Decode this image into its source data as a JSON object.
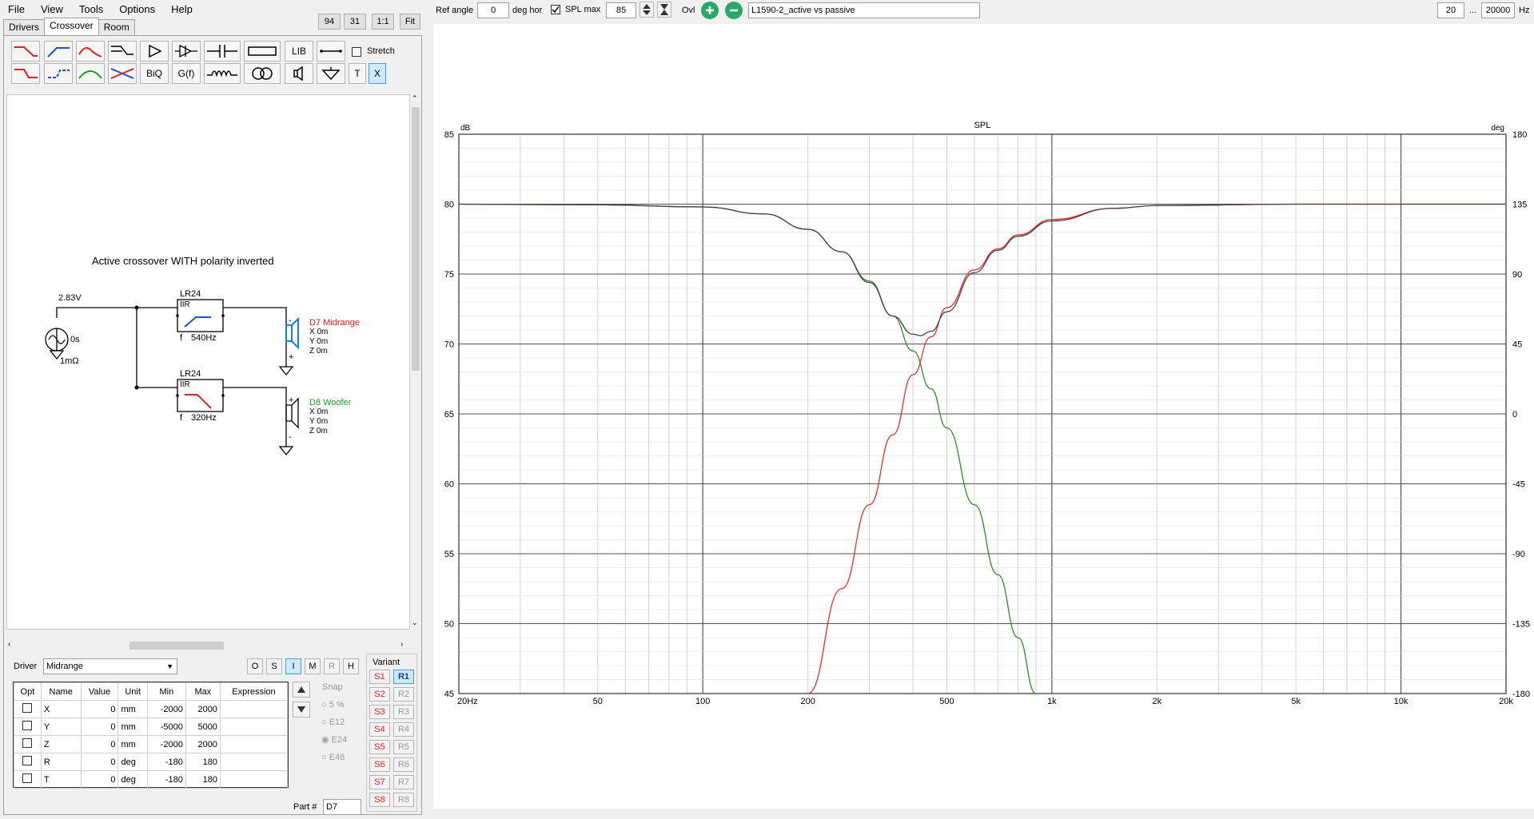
{
  "menu": [
    "File",
    "View",
    "Tools",
    "Options",
    "Help"
  ],
  "zoom_buttons": [
    "94",
    "31",
    "1:1",
    "Fit"
  ],
  "tabs": [
    "Drivers",
    "Crossover",
    "Room"
  ],
  "toolbar": {
    "lib": "LIB",
    "stretch": "Stretch",
    "biq": "BiQ",
    "gf": "G(f)",
    "t": "T",
    "x": "X"
  },
  "schematic": {
    "title": "Active crossover WITH polarity inverted",
    "source": {
      "voltage": "2.83V",
      "delay": "0s",
      "impedance": "1mΩ"
    },
    "block1": {
      "type": "LR24",
      "kind": "IIR",
      "freq_label": "f",
      "freq": "540Hz"
    },
    "block2": {
      "type": "LR24",
      "kind": "IIR",
      "freq_label": "f",
      "freq": "320Hz"
    },
    "driver1": {
      "name": "D7 Midrange",
      "x": "X 0m",
      "y": "Y 0m",
      "z": "Z 0m",
      "minus": "-",
      "plus": "+"
    },
    "driver2": {
      "name": "D8 Woofer",
      "x": "X 0m",
      "y": "Y 0m",
      "z": "Z 0m",
      "minus": "-",
      "plus": "+"
    }
  },
  "driver_panel": {
    "label": "Driver",
    "selected": "Midrange",
    "mode_buttons": [
      "O",
      "S",
      "I",
      "M",
      "R",
      "H"
    ],
    "columns": [
      "Opt",
      "Name",
      "Value",
      "Unit",
      "Min",
      "Max",
      "Expression"
    ],
    "rows": [
      {
        "name": "X",
        "value": "0",
        "unit": "mm",
        "min": "-2000",
        "max": "2000"
      },
      {
        "name": "Y",
        "value": "0",
        "unit": "mm",
        "min": "-5000",
        "max": "5000"
      },
      {
        "name": "Z",
        "value": "0",
        "unit": "mm",
        "min": "-2000",
        "max": "2000"
      },
      {
        "name": "R",
        "value": "0",
        "unit": "deg",
        "min": "-180",
        "max": "180"
      },
      {
        "name": "T",
        "value": "0",
        "unit": "deg",
        "min": "-180",
        "max": "180"
      }
    ],
    "snap": {
      "label": "Snap",
      "options": [
        "5 %",
        "E12",
        "E24",
        "E48"
      ],
      "selected": "E24"
    },
    "part_label": "Part #",
    "part": "D7",
    "variant_label": "Variant",
    "variants_s": [
      "S1",
      "S2",
      "S3",
      "S4",
      "S5",
      "S6",
      "S7",
      "S8"
    ],
    "variants_r": [
      "R1",
      "R2",
      "R3",
      "R4",
      "R5",
      "R6",
      "R7",
      "R8"
    ]
  },
  "top": {
    "ref_angle_label": "Ref angle",
    "ref_angle": "0",
    "deg_hor": "deg hor",
    "spl_max_label": "SPL max",
    "spl_max": "85",
    "ovl": "Ovl",
    "title": "L1590-2_active vs passive",
    "fmin": "20",
    "dots": "...",
    "fmax": "20000",
    "hz": "Hz"
  },
  "chart_data": {
    "type": "line",
    "title": "SPL",
    "ylabel": "dB",
    "y2label": "deg",
    "x_scale": "log",
    "xlim": [
      20,
      20000
    ],
    "ylim": [
      45,
      85
    ],
    "y2lim": [
      -180,
      180
    ],
    "x_ticks": [
      "20Hz",
      "50",
      "100",
      "200",
      "500",
      "1k",
      "2k",
      "5k",
      "10k",
      "20k"
    ],
    "y_ticks": [
      "85",
      "80",
      "75",
      "70",
      "65",
      "60",
      "55",
      "50",
      "45"
    ],
    "y2_ticks": [
      "180",
      "135",
      "90",
      "45",
      "0",
      "-45",
      "-90",
      "-135",
      "-180"
    ],
    "grid": true,
    "series": [
      {
        "color": "#2e8b2e",
        "x": [
          20,
          50,
          100,
          150,
          200,
          250,
          300,
          350,
          400,
          450,
          500,
          600,
          700,
          800,
          900
        ],
        "y": [
          80,
          79.95,
          79.8,
          79.3,
          78.2,
          76.6,
          74.5,
          72.0,
          69.5,
          66.8,
          64.0,
          58.5,
          53.5,
          49.0,
          45.0
        ]
      },
      {
        "color": "#e03030",
        "x": [
          200,
          250,
          300,
          350,
          400,
          450,
          500,
          600,
          700,
          800,
          1000,
          1500,
          2000,
          5000,
          20000
        ],
        "y": [
          45,
          52.5,
          58.5,
          63.5,
          67.8,
          70.5,
          72.6,
          75.3,
          76.8,
          77.8,
          78.9,
          79.7,
          79.9,
          80,
          80
        ]
      },
      {
        "color": "#444444",
        "x": [
          20,
          50,
          100,
          150,
          200,
          250,
          300,
          350,
          400,
          420,
          450,
          500,
          600,
          700,
          800,
          1000,
          1500,
          2000,
          5000,
          20000
        ],
        "y": [
          80,
          79.95,
          79.8,
          79.3,
          78.2,
          76.6,
          74.4,
          72.0,
          70.7,
          70.6,
          70.9,
          72.3,
          75.1,
          76.7,
          77.7,
          78.8,
          79.7,
          79.9,
          80,
          80
        ]
      }
    ]
  }
}
